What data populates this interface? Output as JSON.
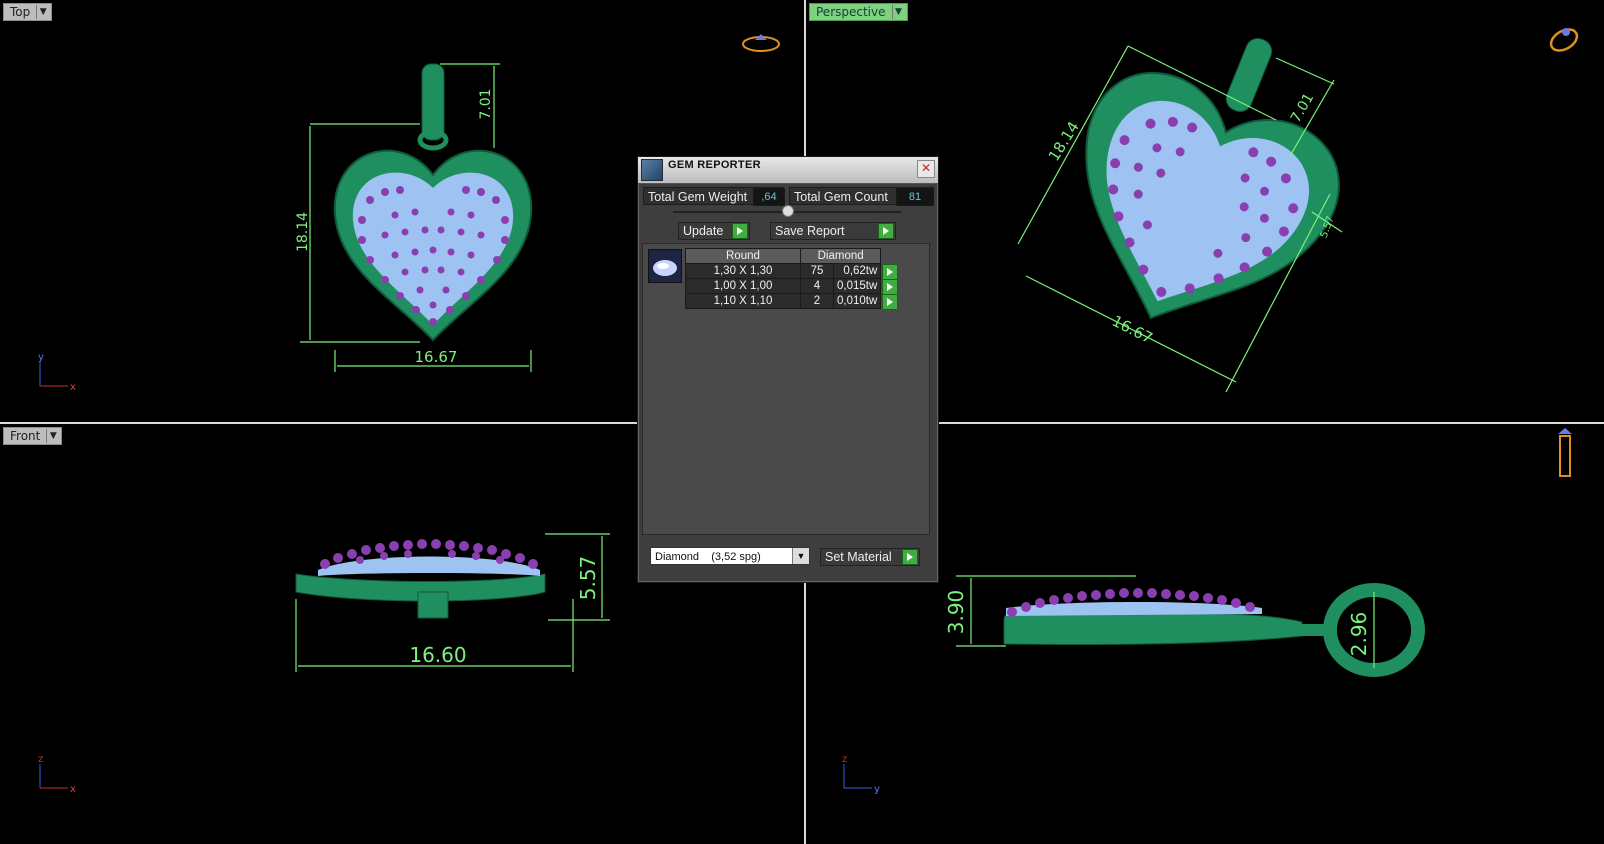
{
  "viewports": {
    "top": {
      "label": "Top",
      "dims": {
        "height": "18.14",
        "width": "16.67",
        "bail": "7.01"
      },
      "axes": [
        "y",
        "x"
      ]
    },
    "perspective": {
      "label": "Perspective",
      "dims": {
        "height": "18.14",
        "width": "16.67",
        "bail": "7.01",
        "depth": "5.57"
      }
    },
    "front": {
      "label": "Front",
      "dims": {
        "width": "16.60",
        "height": "5.57"
      },
      "axes": [
        "z",
        "x"
      ]
    },
    "side": {
      "dims": {
        "height": "3.90",
        "bail": "2.96"
      },
      "axes": [
        "z",
        "y"
      ]
    }
  },
  "gem_reporter": {
    "title": "GEM REPORTER",
    "total_weight_label": "Total Gem Weight",
    "total_weight_value": ",64",
    "total_count_label": "Total Gem Count",
    "total_count_value": "81",
    "update_label": "Update",
    "save_report_label": "Save Report",
    "table_headers": [
      "Round",
      "Diamond"
    ],
    "rows": [
      {
        "size": "1,30 X 1,30",
        "count": "75",
        "weight": "0,62tw"
      },
      {
        "size": "1,00 X 1,00",
        "count": "4",
        "weight": "0,015tw"
      },
      {
        "size": "1,10 X 1,10",
        "count": "2",
        "weight": "0,010tw"
      }
    ],
    "material_value": "Diamond    (3,52 spg)",
    "set_material_label": "Set Material"
  },
  "colors": {
    "metal": "#1f8f5f",
    "gem_stone": "#8a3fb0",
    "seat": "#9ec3f2",
    "dimension": "#7cf27c"
  }
}
